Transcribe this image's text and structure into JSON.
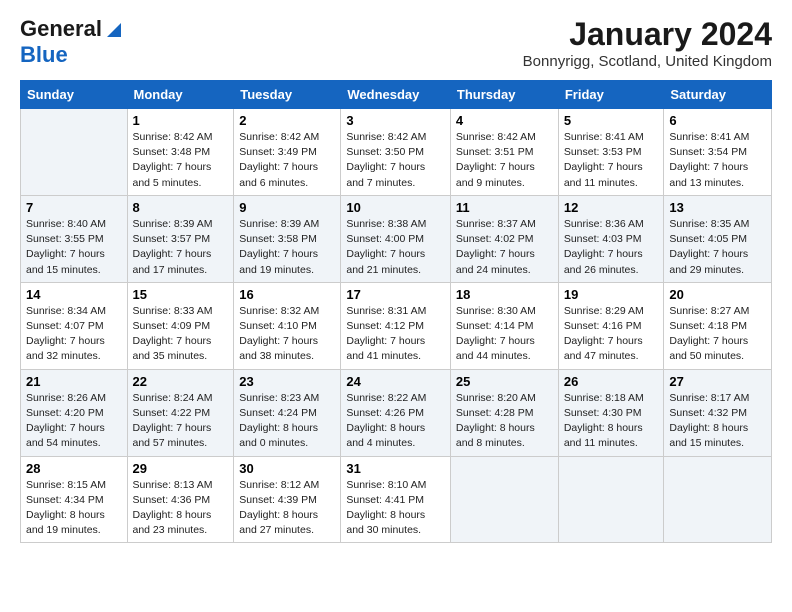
{
  "logo": {
    "line1": "General",
    "line2": "Blue"
  },
  "title": "January 2024",
  "location": "Bonnyrigg, Scotland, United Kingdom",
  "days_of_week": [
    "Sunday",
    "Monday",
    "Tuesday",
    "Wednesday",
    "Thursday",
    "Friday",
    "Saturday"
  ],
  "weeks": [
    [
      {
        "num": "",
        "sunrise": "",
        "sunset": "",
        "daylight": ""
      },
      {
        "num": "1",
        "sunrise": "Sunrise: 8:42 AM",
        "sunset": "Sunset: 3:48 PM",
        "daylight": "Daylight: 7 hours and 5 minutes."
      },
      {
        "num": "2",
        "sunrise": "Sunrise: 8:42 AM",
        "sunset": "Sunset: 3:49 PM",
        "daylight": "Daylight: 7 hours and 6 minutes."
      },
      {
        "num": "3",
        "sunrise": "Sunrise: 8:42 AM",
        "sunset": "Sunset: 3:50 PM",
        "daylight": "Daylight: 7 hours and 7 minutes."
      },
      {
        "num": "4",
        "sunrise": "Sunrise: 8:42 AM",
        "sunset": "Sunset: 3:51 PM",
        "daylight": "Daylight: 7 hours and 9 minutes."
      },
      {
        "num": "5",
        "sunrise": "Sunrise: 8:41 AM",
        "sunset": "Sunset: 3:53 PM",
        "daylight": "Daylight: 7 hours and 11 minutes."
      },
      {
        "num": "6",
        "sunrise": "Sunrise: 8:41 AM",
        "sunset": "Sunset: 3:54 PM",
        "daylight": "Daylight: 7 hours and 13 minutes."
      }
    ],
    [
      {
        "num": "7",
        "sunrise": "Sunrise: 8:40 AM",
        "sunset": "Sunset: 3:55 PM",
        "daylight": "Daylight: 7 hours and 15 minutes."
      },
      {
        "num": "8",
        "sunrise": "Sunrise: 8:39 AM",
        "sunset": "Sunset: 3:57 PM",
        "daylight": "Daylight: 7 hours and 17 minutes."
      },
      {
        "num": "9",
        "sunrise": "Sunrise: 8:39 AM",
        "sunset": "Sunset: 3:58 PM",
        "daylight": "Daylight: 7 hours and 19 minutes."
      },
      {
        "num": "10",
        "sunrise": "Sunrise: 8:38 AM",
        "sunset": "Sunset: 4:00 PM",
        "daylight": "Daylight: 7 hours and 21 minutes."
      },
      {
        "num": "11",
        "sunrise": "Sunrise: 8:37 AM",
        "sunset": "Sunset: 4:02 PM",
        "daylight": "Daylight: 7 hours and 24 minutes."
      },
      {
        "num": "12",
        "sunrise": "Sunrise: 8:36 AM",
        "sunset": "Sunset: 4:03 PM",
        "daylight": "Daylight: 7 hours and 26 minutes."
      },
      {
        "num": "13",
        "sunrise": "Sunrise: 8:35 AM",
        "sunset": "Sunset: 4:05 PM",
        "daylight": "Daylight: 7 hours and 29 minutes."
      }
    ],
    [
      {
        "num": "14",
        "sunrise": "Sunrise: 8:34 AM",
        "sunset": "Sunset: 4:07 PM",
        "daylight": "Daylight: 7 hours and 32 minutes."
      },
      {
        "num": "15",
        "sunrise": "Sunrise: 8:33 AM",
        "sunset": "Sunset: 4:09 PM",
        "daylight": "Daylight: 7 hours and 35 minutes."
      },
      {
        "num": "16",
        "sunrise": "Sunrise: 8:32 AM",
        "sunset": "Sunset: 4:10 PM",
        "daylight": "Daylight: 7 hours and 38 minutes."
      },
      {
        "num": "17",
        "sunrise": "Sunrise: 8:31 AM",
        "sunset": "Sunset: 4:12 PM",
        "daylight": "Daylight: 7 hours and 41 minutes."
      },
      {
        "num": "18",
        "sunrise": "Sunrise: 8:30 AM",
        "sunset": "Sunset: 4:14 PM",
        "daylight": "Daylight: 7 hours and 44 minutes."
      },
      {
        "num": "19",
        "sunrise": "Sunrise: 8:29 AM",
        "sunset": "Sunset: 4:16 PM",
        "daylight": "Daylight: 7 hours and 47 minutes."
      },
      {
        "num": "20",
        "sunrise": "Sunrise: 8:27 AM",
        "sunset": "Sunset: 4:18 PM",
        "daylight": "Daylight: 7 hours and 50 minutes."
      }
    ],
    [
      {
        "num": "21",
        "sunrise": "Sunrise: 8:26 AM",
        "sunset": "Sunset: 4:20 PM",
        "daylight": "Daylight: 7 hours and 54 minutes."
      },
      {
        "num": "22",
        "sunrise": "Sunrise: 8:24 AM",
        "sunset": "Sunset: 4:22 PM",
        "daylight": "Daylight: 7 hours and 57 minutes."
      },
      {
        "num": "23",
        "sunrise": "Sunrise: 8:23 AM",
        "sunset": "Sunset: 4:24 PM",
        "daylight": "Daylight: 8 hours and 0 minutes."
      },
      {
        "num": "24",
        "sunrise": "Sunrise: 8:22 AM",
        "sunset": "Sunset: 4:26 PM",
        "daylight": "Daylight: 8 hours and 4 minutes."
      },
      {
        "num": "25",
        "sunrise": "Sunrise: 8:20 AM",
        "sunset": "Sunset: 4:28 PM",
        "daylight": "Daylight: 8 hours and 8 minutes."
      },
      {
        "num": "26",
        "sunrise": "Sunrise: 8:18 AM",
        "sunset": "Sunset: 4:30 PM",
        "daylight": "Daylight: 8 hours and 11 minutes."
      },
      {
        "num": "27",
        "sunrise": "Sunrise: 8:17 AM",
        "sunset": "Sunset: 4:32 PM",
        "daylight": "Daylight: 8 hours and 15 minutes."
      }
    ],
    [
      {
        "num": "28",
        "sunrise": "Sunrise: 8:15 AM",
        "sunset": "Sunset: 4:34 PM",
        "daylight": "Daylight: 8 hours and 19 minutes."
      },
      {
        "num": "29",
        "sunrise": "Sunrise: 8:13 AM",
        "sunset": "Sunset: 4:36 PM",
        "daylight": "Daylight: 8 hours and 23 minutes."
      },
      {
        "num": "30",
        "sunrise": "Sunrise: 8:12 AM",
        "sunset": "Sunset: 4:39 PM",
        "daylight": "Daylight: 8 hours and 27 minutes."
      },
      {
        "num": "31",
        "sunrise": "Sunrise: 8:10 AM",
        "sunset": "Sunset: 4:41 PM",
        "daylight": "Daylight: 8 hours and 30 minutes."
      },
      {
        "num": "",
        "sunrise": "",
        "sunset": "",
        "daylight": ""
      },
      {
        "num": "",
        "sunrise": "",
        "sunset": "",
        "daylight": ""
      },
      {
        "num": "",
        "sunrise": "",
        "sunset": "",
        "daylight": ""
      }
    ]
  ]
}
